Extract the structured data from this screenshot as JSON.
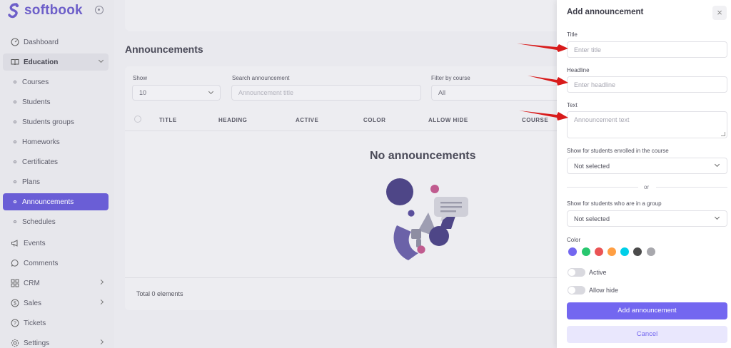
{
  "app": {
    "logo_text": "softbook"
  },
  "colors": {
    "accent": "#7367f0",
    "active_nav": "#6a5ed6",
    "arrow": "#d81b1b"
  },
  "sidebar": {
    "items": [
      {
        "label": "Dashboard",
        "icon": "dashboard-icon"
      },
      {
        "label": "Education",
        "icon": "book-icon"
      },
      {
        "label": "Courses"
      },
      {
        "label": "Students"
      },
      {
        "label": "Students groups"
      },
      {
        "label": "Homeworks"
      },
      {
        "label": "Certificates"
      },
      {
        "label": "Plans"
      },
      {
        "label": "Announcements"
      },
      {
        "label": "Schedules"
      },
      {
        "label": "Events",
        "icon": "megaphone-icon"
      },
      {
        "label": "Comments",
        "icon": "comment-icon"
      },
      {
        "label": "CRM",
        "icon": "grid-icon"
      },
      {
        "label": "Sales",
        "icon": "dollar-icon"
      },
      {
        "label": "Tickets",
        "icon": "help-icon"
      },
      {
        "label": "Settings",
        "icon": "gear-icon"
      }
    ]
  },
  "main": {
    "title": "Announcements",
    "filters": {
      "show_label": "Show",
      "show_value": "10",
      "search_label": "Search announcement",
      "search_placeholder": "Announcement title",
      "course_label": "Filter by course",
      "course_value": "All"
    },
    "columns": [
      "TITLE",
      "HEADING",
      "ACTIVE",
      "COLOR",
      "ALLOW HIDE",
      "COURSE"
    ],
    "empty_text": "No announcements",
    "footer_text": "Total 0 elements"
  },
  "drawer": {
    "title": "Add announcement",
    "close_symbol": "×",
    "title_label": "Title",
    "title_placeholder": "Enter title",
    "headline_label": "Headline",
    "headline_placeholder": "Enter headline",
    "text_label": "Text",
    "text_placeholder": "Announcement text",
    "course_label": "Show for students enrolled in the course",
    "course_value": "Not selected",
    "or_text": "or",
    "group_label": "Show for students who are in a group",
    "group_value": "Not selected",
    "color_label": "Color",
    "swatches": [
      "#7367f0",
      "#28c76f",
      "#ea5455",
      "#ff9f43",
      "#00cfe8",
      "#4b4b4b",
      "#a8a8ad"
    ],
    "active_label": "Active",
    "allow_hide_label": "Allow hide",
    "submit_label": "Add announcement",
    "cancel_label": "Cancel"
  }
}
